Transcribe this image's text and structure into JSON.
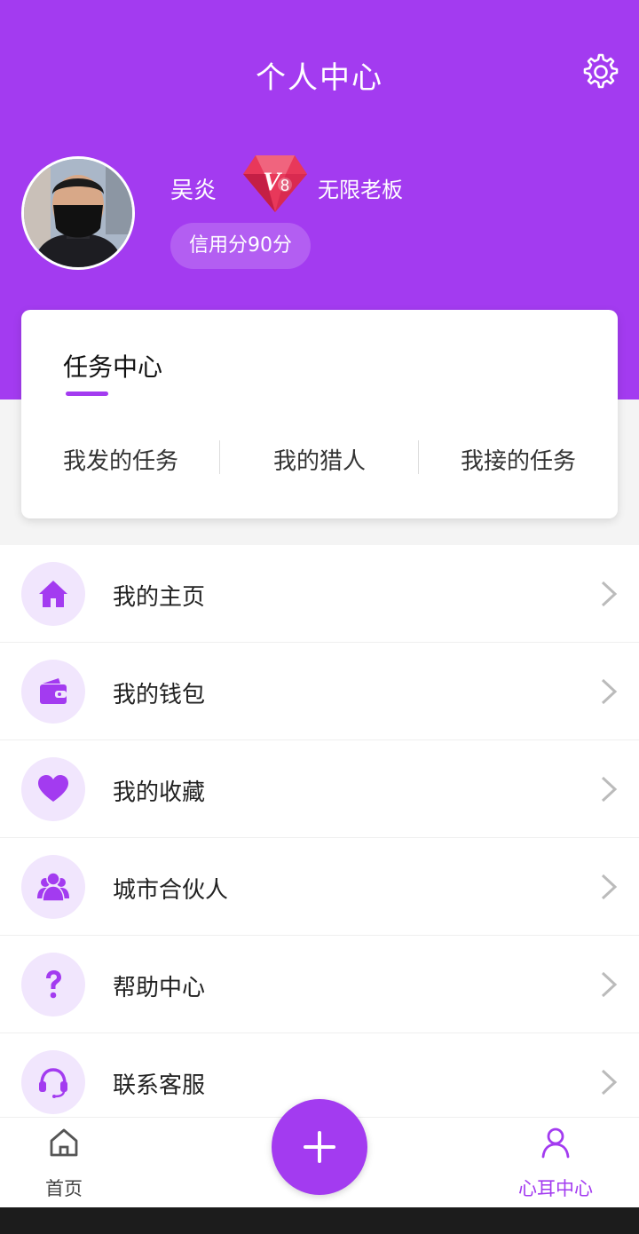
{
  "header": {
    "title": "个人中心",
    "settings_icon": "gear-icon",
    "background": "#a33bf0"
  },
  "profile": {
    "name": "吴炎",
    "vip_level": "8",
    "vip_title": "无限老板",
    "credit": "信用分90分"
  },
  "task_center": {
    "title": "任务中心",
    "items": [
      "我发的任务",
      "我的猎人",
      "我接的任务"
    ]
  },
  "menu": {
    "items": [
      {
        "label": "我的主页",
        "icon": "home-icon"
      },
      {
        "label": "我的钱包",
        "icon": "wallet-icon"
      },
      {
        "label": "我的收藏",
        "icon": "heart-icon"
      },
      {
        "label": "城市合伙人",
        "icon": "team-icon"
      },
      {
        "label": "帮助中心",
        "icon": "question-icon"
      },
      {
        "label": "联系客服",
        "icon": "headset-icon"
      }
    ]
  },
  "tabbar": {
    "home_label": "首页",
    "profile_label": "心耳中心",
    "active_color": "#a33bf0",
    "inactive_color": "#444444"
  }
}
